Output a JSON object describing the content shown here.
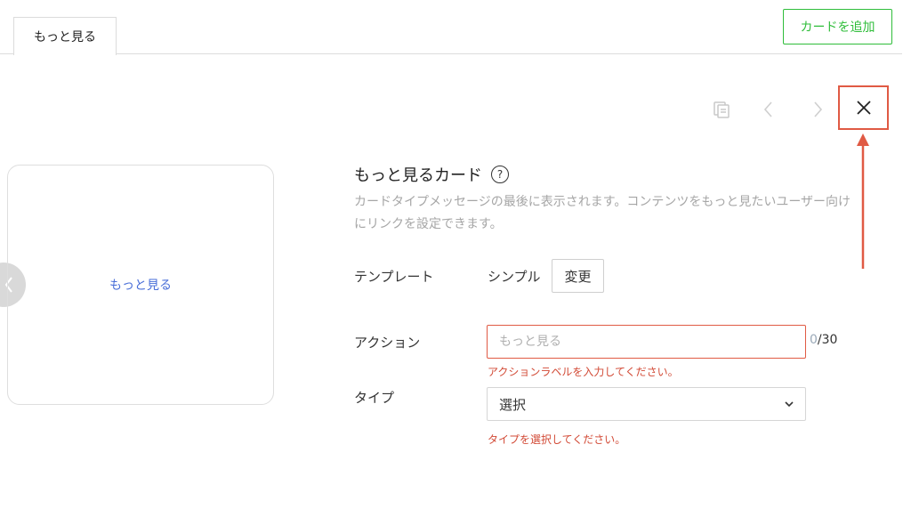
{
  "tabs": [
    {
      "label": "もっと見る"
    }
  ],
  "toolbar": {
    "add_card_label": "カードを追加",
    "icons": [
      "copy-icon",
      "chevron-left-icon",
      "chevron-right-icon",
      "close-icon"
    ]
  },
  "preview": {
    "label": "もっと見る"
  },
  "section": {
    "title": "もっと見るカード",
    "help_glyph": "?",
    "description": "カードタイプメッセージの最後に表示されます。コンテンツをもっと見たいユーザー向けにリンクを設定できます。"
  },
  "template": {
    "label": "テンプレート",
    "value": "シンプル",
    "change_label": "変更"
  },
  "action": {
    "label": "アクション",
    "placeholder": "もっと見る",
    "value": "",
    "count_current": "0",
    "count_max": "/30",
    "error": "アクションラベルを入力してください。"
  },
  "type": {
    "label": "タイプ",
    "selected": "選択",
    "error": "タイプを選択してください。"
  },
  "colors": {
    "accent_green": "#2fbd3a",
    "error_red": "#e05a44",
    "link_blue": "#4a6fd8"
  }
}
